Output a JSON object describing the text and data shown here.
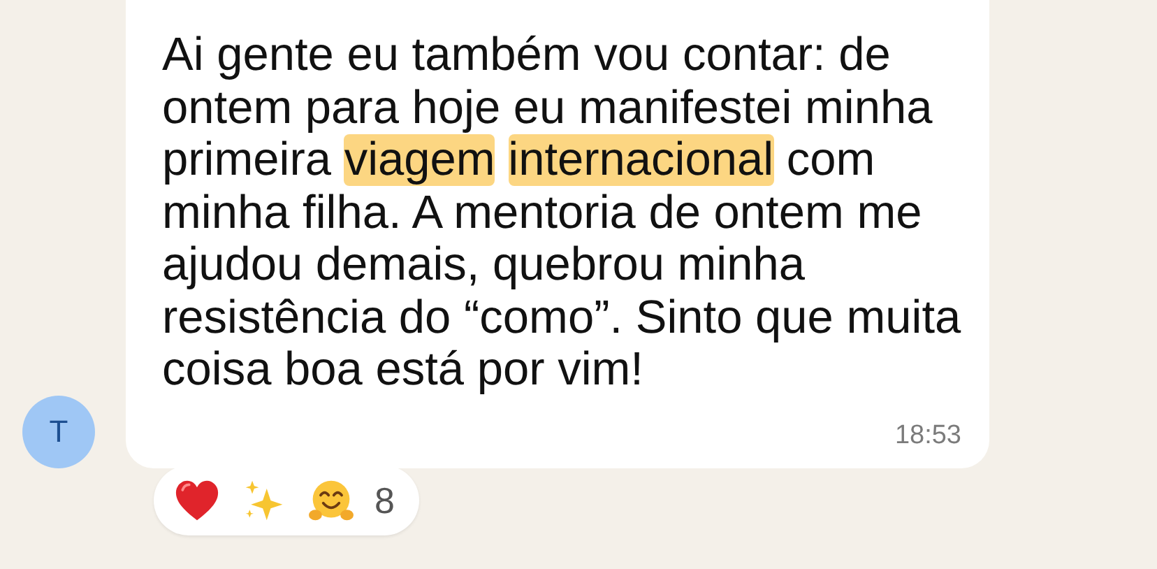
{
  "sender": {
    "initial": "T"
  },
  "message": {
    "lines": [
      [
        {
          "text": "Ai gente eu também vou contar: de",
          "highlighted": false
        }
      ],
      [
        {
          "text": "ontem para hoje eu manifestei minha",
          "highlighted": false
        }
      ],
      [
        {
          "text": "primeira ",
          "highlighted": false
        },
        {
          "text": "viagem ",
          "highlighted": true
        },
        {
          "text": "internacional",
          "highlighted": true
        },
        {
          "text": " com",
          "highlighted": false
        }
      ],
      [
        {
          "text": "minha filha. A mentoria de ontem me",
          "highlighted": false
        }
      ],
      [
        {
          "text": "ajudou demais, quebrou minha",
          "highlighted": false
        }
      ],
      [
        {
          "text": "resistência do “como”. Sinto que muita",
          "highlighted": false
        }
      ],
      [
        {
          "text": "coisa boa está por vim!",
          "highlighted": false
        }
      ]
    ],
    "time": "18:53"
  },
  "reactions": {
    "emojis": [
      {
        "kind": "heart"
      },
      {
        "kind": "sparkles"
      },
      {
        "kind": "hug"
      }
    ],
    "count": "8"
  }
}
